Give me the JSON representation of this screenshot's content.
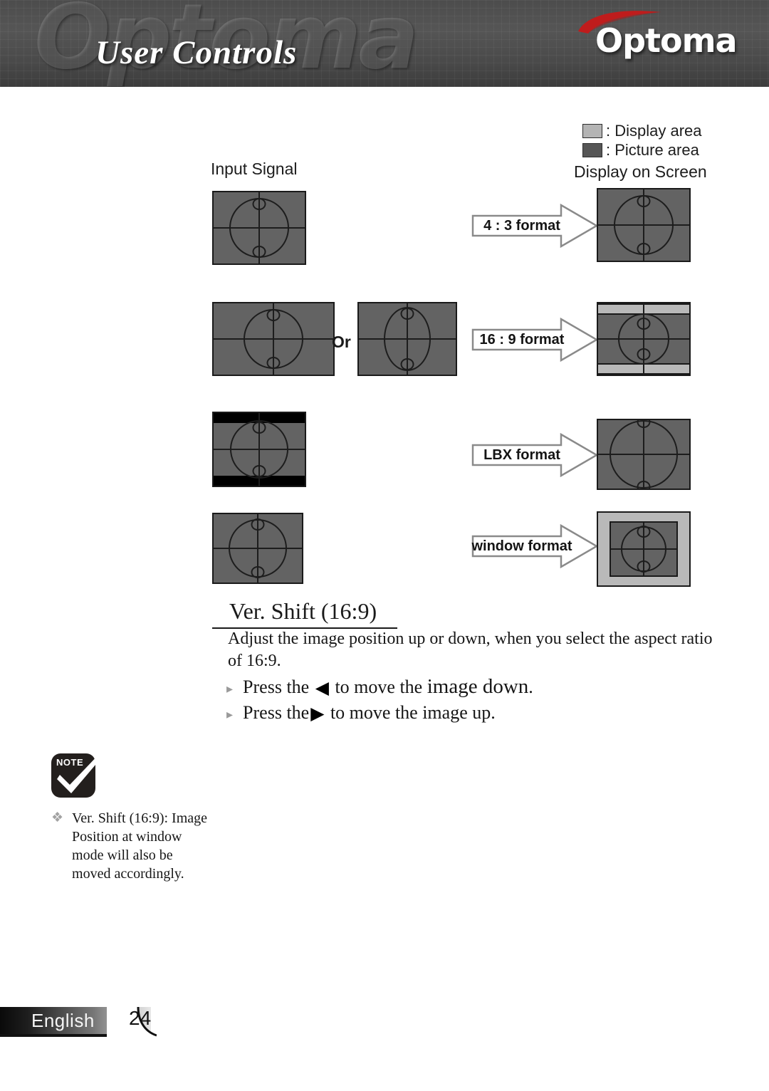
{
  "header": {
    "title": "User Controls",
    "watermark": "Optoma",
    "brand": "Optoma"
  },
  "legend": {
    "display_area": ": Display area",
    "picture_area": ": Picture area",
    "display_swatch_color": "#b4b4b4",
    "picture_swatch_color": "#565656"
  },
  "columns": {
    "input": "Input Signal",
    "output": "Display on Screen"
  },
  "diagram": {
    "or_label": "Or",
    "rows": [
      {
        "format_label": "4 : 3 format"
      },
      {
        "format_label": "16 : 9 format"
      },
      {
        "format_label": "LBX format"
      },
      {
        "format_label": "window format"
      }
    ]
  },
  "section": {
    "title": "Ver. Shift (16:9)",
    "description": "Adjust the image position up or down, when you select the aspect ratio of 16:9.",
    "bullets": [
      {
        "prefix": "Press the ",
        "key": "◀",
        "mid": " to move the ",
        "emphasis": "image down",
        "suffix": "."
      },
      {
        "prefix": "Press the",
        "key": "▶",
        "mid": " to move the image up",
        "emphasis": "",
        "suffix": "."
      }
    ]
  },
  "note": {
    "icon_label": "NOTE",
    "bullet": "❖",
    "text": "Ver. Shift (16:9): Image Position at window mode will also be moved accordingly."
  },
  "footer": {
    "language": "English",
    "page_number": "24"
  }
}
